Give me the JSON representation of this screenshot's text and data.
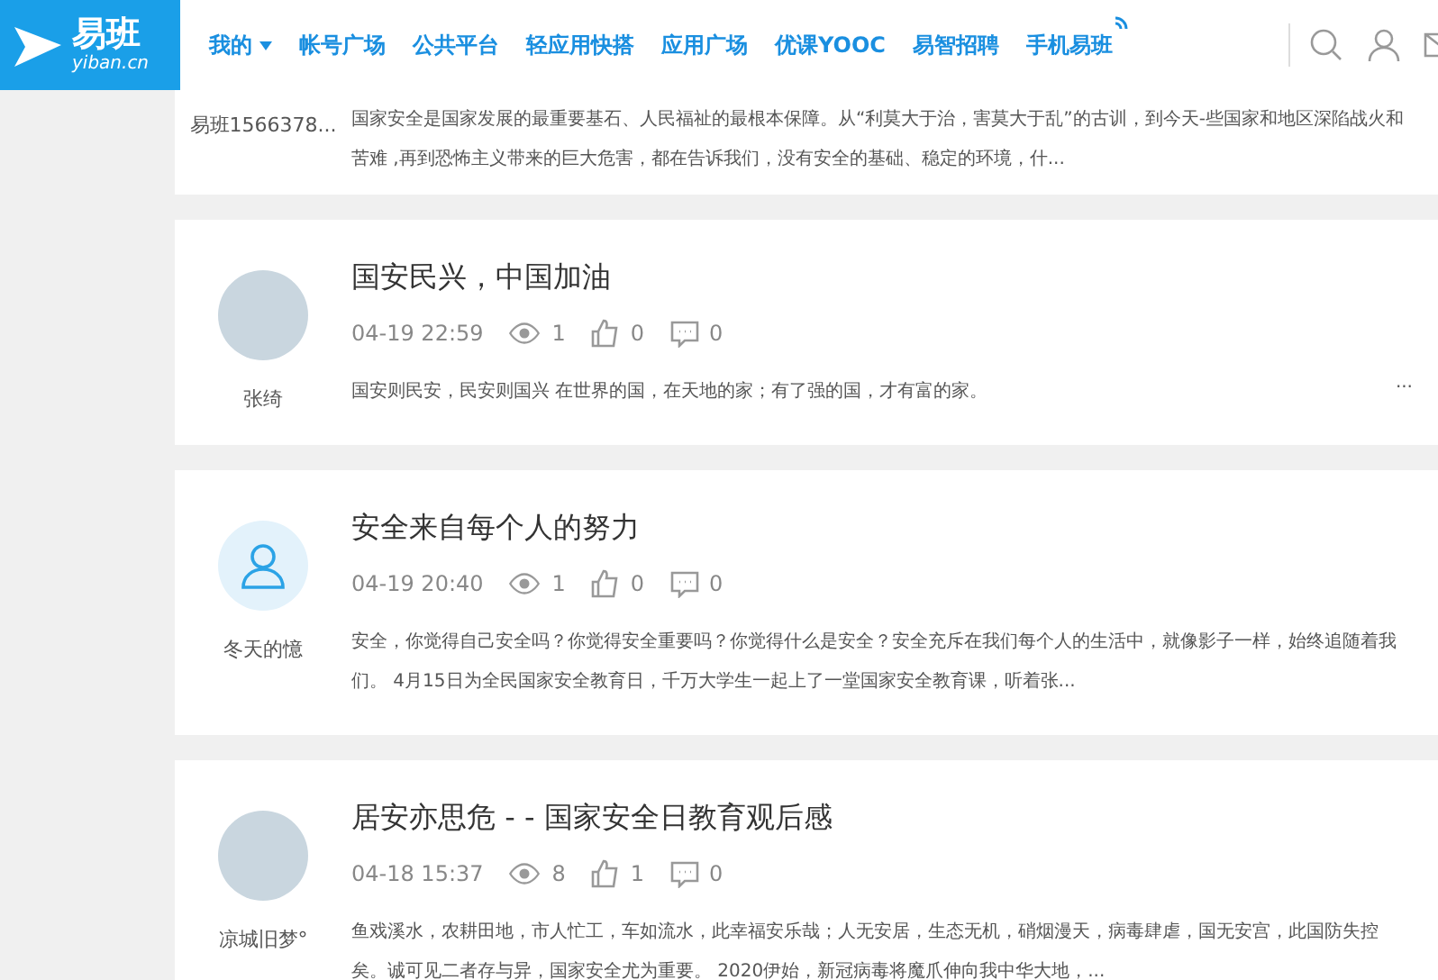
{
  "header": {
    "logo": {
      "name": "易班",
      "domain": "yiban.cn"
    },
    "nav": [
      {
        "label": "我的",
        "dropdown": true,
        "badge": false
      },
      {
        "label": "帐号广场",
        "dropdown": false,
        "badge": false
      },
      {
        "label": "公共平台",
        "dropdown": false,
        "badge": false
      },
      {
        "label": "轻应用快搭",
        "dropdown": false,
        "badge": false
      },
      {
        "label": "应用广场",
        "dropdown": false,
        "badge": false
      },
      {
        "label": "优课YOOC",
        "dropdown": false,
        "badge": false
      },
      {
        "label": "易智招聘",
        "dropdown": false,
        "badge": false
      },
      {
        "label": "手机易班",
        "dropdown": false,
        "badge": true
      }
    ]
  },
  "posts": [
    {
      "author": "易班1566378...",
      "excerpt": "国家安全是国家发展的最重要基石、人民福祉的最根本保障。从“利莫大于治，害莫大于乱”的古训，到今天-些国家和地区深陷战火和苦难 ,再到恐怖主义带来的巨大危害，都在告诉我们，没有安全的基础、稳定的环境，什...",
      "partial": true
    },
    {
      "author": "张绮",
      "kind": "photo",
      "title": "国安民兴，中国加油",
      "time": "04-19 22:59",
      "views": "1",
      "likes": "0",
      "comments": "0",
      "excerpt": "国安则民安，民安则国兴   在世界的国，在天地的家；有了强的国，才有富的家。",
      "more": "...",
      "partial": false
    },
    {
      "author": "冬天的憶",
      "kind": "default",
      "title": "安全来自每个人的努力",
      "time": "04-19 20:40",
      "views": "1",
      "likes": "0",
      "comments": "0",
      "excerpt": "安全，你觉得自己安全吗？你觉得安全重要吗？你觉得什么是安全？安全充斥在我们每个人的生活中，就像影子一样，始终追随着我们。  4月15日为全民国家安全教育日，千万大学生一起上了一堂国家安全教育课，听着张...",
      "partial": false
    },
    {
      "author": "凉城旧梦°",
      "kind": "photo",
      "title": "居安亦思危 -  - 国家安全日教育观后感",
      "time": "04-18 15:37",
      "views": "8",
      "likes": "1",
      "comments": "0",
      "excerpt": "鱼戏溪水，农耕田地，市人忙工，车如流水，此幸福安乐哉；人无安居，生态无机，硝烟漫天，病毒肆虐，国无安宫，此国防失控矣。诚可见二者存与异，国家安全尤为重要。 2020伊始，新冠病毒将魔爪伸向我中华大地，...",
      "partial": false
    }
  ]
}
